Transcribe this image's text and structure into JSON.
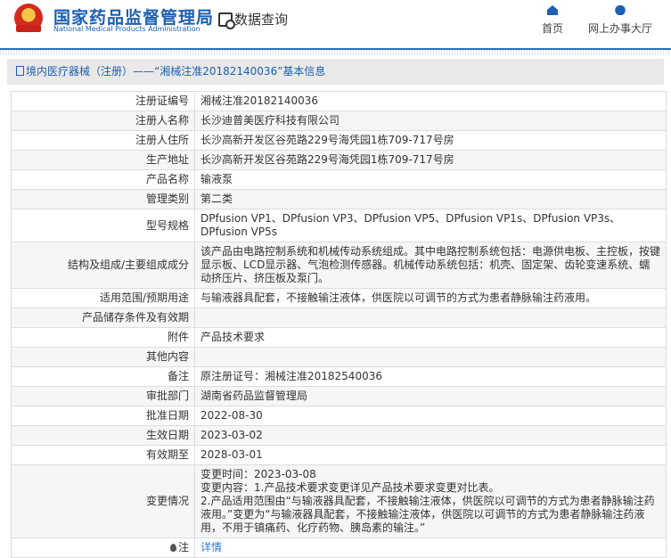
{
  "header": {
    "logo_cn": "国家药品监督管理局",
    "logo_en": "National Medical Products Administration",
    "data_query": "数据查询",
    "nav": [
      {
        "label": "首页",
        "icon": "home-icon"
      },
      {
        "label": "网上办事大厅",
        "icon": "user-icon"
      }
    ]
  },
  "breadcrumb": "境内医疗器械（注册）——“湘械注准20182140036”基本信息",
  "rows": [
    {
      "label": "注册证编号",
      "value": "湘械注准20182140036"
    },
    {
      "label": "注册人名称",
      "value": "长沙迪普美医疗科技有限公司"
    },
    {
      "label": "注册人住所",
      "value": "长沙高新开发区谷苑路229号海凭园1栋709-717号房"
    },
    {
      "label": "生产地址",
      "value": "长沙高新开发区谷苑路229号海凭园1栋709-717号房"
    },
    {
      "label": "产品名称",
      "value": "输液泵"
    },
    {
      "label": "管理类别",
      "value": "第二类"
    },
    {
      "label": "型号规格",
      "value": "DPfusion VP1、DPfusion VP3、DPfusion VP5、DPfusion VP1s、DPfusion VP3s、DPfusion VP5s"
    },
    {
      "label": "结构及组成/主要组成成分",
      "value": "该产品由电路控制系统和机械传动系统组成。其中电路控制系统包括：电源供电板、主控板，按键显示板、LCD显示器、气泡检测传感器。机械传动系统包括：机壳、固定架、齿轮变速系统、蠕动挤压片、挤压板及泵门。"
    },
    {
      "label": "适用范围/预期用途",
      "value": "与输液器具配套，不接触输注液体，供医院以可调节的方式为患者静脉输注药液用。"
    },
    {
      "label": "产品储存条件及有效期",
      "value": ""
    },
    {
      "label": "附件",
      "value": "产品技术要求"
    },
    {
      "label": "其他内容",
      "value": ""
    },
    {
      "label": "备注",
      "value": "原注册证号：湘械注准20182540036"
    },
    {
      "label": "审批部门",
      "value": "湖南省药品监督管理局"
    },
    {
      "label": "批准日期",
      "value": "2022-08-30"
    },
    {
      "label": "生效日期",
      "value": "2023-03-02"
    },
    {
      "label": "有效期至",
      "value": "2028-03-01"
    }
  ],
  "change": {
    "label": "变更情况",
    "lines": [
      "变更时间：2023-03-08",
      "变更内容：1.产品技术要求变更详见产品技术要求变更对比表。",
      "2.产品适用范围由“与输液器具配套，不接触输注液体，供医院以可调节的方式为患者静脉输注药液用。”变更为“与输液器具配套，不接触输注液体，供医院以可调节的方式为患者静脉输注药液用，不用于镇痛药、化疗药物、胰岛素的输注。”"
    ]
  },
  "note": {
    "label": "注",
    "link": "详情"
  }
}
